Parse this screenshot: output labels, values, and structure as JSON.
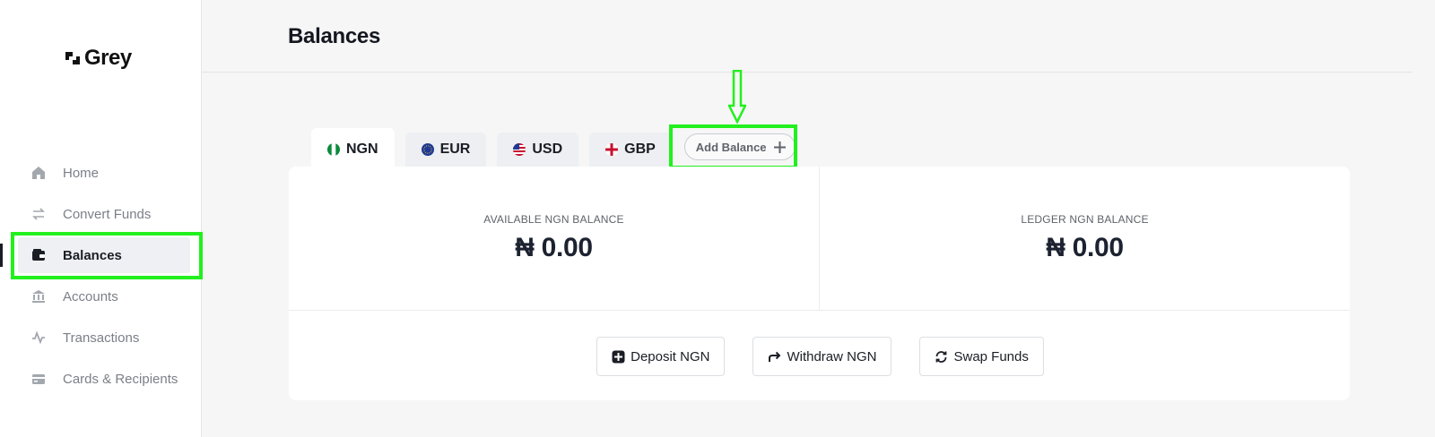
{
  "brand": {
    "name": "Grey"
  },
  "sidebar": {
    "items": [
      {
        "label": "Home",
        "icon": "home-icon"
      },
      {
        "label": "Convert Funds",
        "icon": "convert-icon"
      },
      {
        "label": "Balances",
        "icon": "wallet-icon",
        "active": true
      },
      {
        "label": "Accounts",
        "icon": "bank-icon"
      },
      {
        "label": "Transactions",
        "icon": "activity-icon"
      },
      {
        "label": "Cards & Recipients",
        "icon": "card-icon"
      }
    ]
  },
  "header": {
    "title": "Balances"
  },
  "tabs": [
    {
      "label": "NGN",
      "flag": "nigeria-flag-icon",
      "active": true
    },
    {
      "label": "EUR",
      "flag": "eu-flag-icon"
    },
    {
      "label": "USD",
      "flag": "us-flag-icon"
    },
    {
      "label": "GBP",
      "flag": "uk-flag-icon"
    }
  ],
  "add_balance": {
    "label": "Add Balance"
  },
  "balances": {
    "available": {
      "label": "AVAILABLE NGN BALANCE",
      "value": "₦ 0.00"
    },
    "ledger": {
      "label": "LEDGER NGN BALANCE",
      "value": "₦ 0.00"
    }
  },
  "actions": {
    "deposit": "Deposit NGN",
    "withdraw": "Withdraw NGN",
    "swap": "Swap Funds"
  },
  "colors": {
    "highlight": "#22f01e",
    "text_dark": "#1c2230",
    "text_muted": "#7b7f88",
    "background": "#f6f6f6"
  }
}
